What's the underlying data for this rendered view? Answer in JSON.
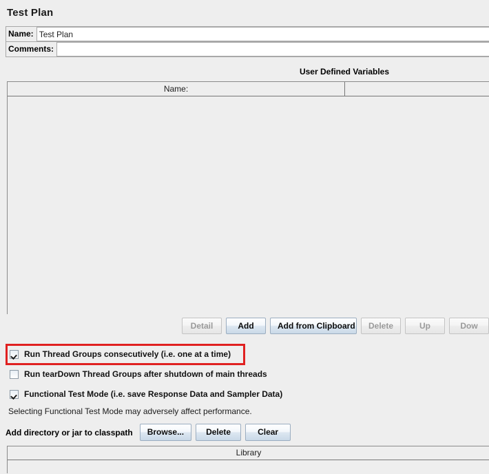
{
  "title": "Test Plan",
  "fields": {
    "name_label": "Name:",
    "name_value": "Test Plan",
    "comments_label": "Comments:",
    "comments_value": ""
  },
  "user_defined_variables": {
    "title": "User Defined Variables",
    "columns": [
      "Name:",
      ""
    ],
    "rows": [],
    "buttons": [
      {
        "label": "Detail",
        "enabled": false
      },
      {
        "label": "Add",
        "enabled": true
      },
      {
        "label": "Add from Clipboard",
        "enabled": true
      },
      {
        "label": "Delete",
        "enabled": false
      },
      {
        "label": "Up",
        "enabled": false
      },
      {
        "label": "Dow",
        "enabled": false
      }
    ]
  },
  "options": [
    {
      "label": "Run Thread Groups consecutively (i.e. one at a time)",
      "checked": true,
      "highlighted": true
    },
    {
      "label": "Run tearDown Thread Groups after shutdown of main threads",
      "checked": false,
      "highlighted": false
    },
    {
      "label": "Functional Test Mode (i.e. save Response Data and  Sampler Data)",
      "checked": true,
      "highlighted": false
    }
  ],
  "warning": "Selecting Functional Test Mode may adversely affect performance.",
  "classpath": {
    "label": "Add directory or jar to classpath",
    "buttons": [
      "Browse...",
      "Delete",
      "Clear"
    ]
  },
  "library": {
    "column": "Library",
    "rows": []
  },
  "colors": {
    "background": "#eeeeee",
    "annotation": "#e02020",
    "button_accent": "#c9d9e8"
  }
}
